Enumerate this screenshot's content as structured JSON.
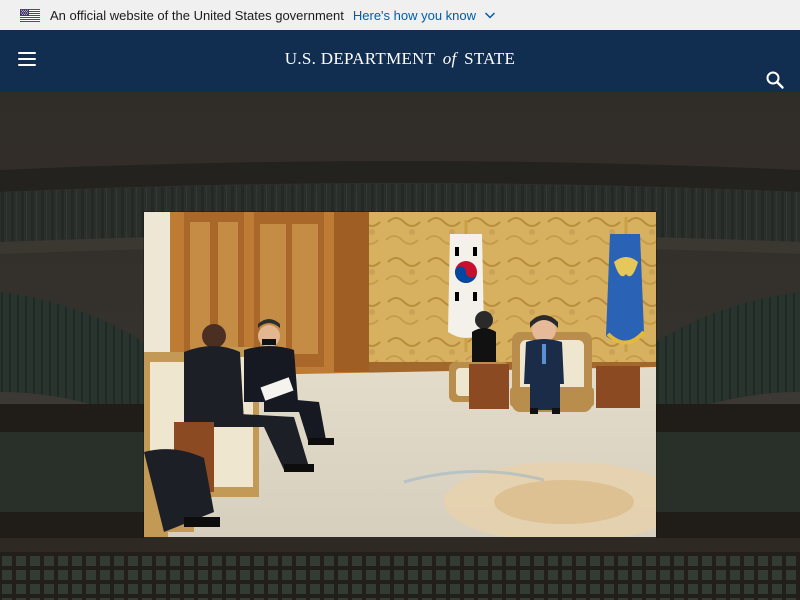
{
  "banner": {
    "flag_icon": "us-flag-icon",
    "official_text": "An official website of the United States government",
    "how_you_know_link": "Here's how you know",
    "chevron_icon": "chevron-down-icon"
  },
  "header": {
    "menu_icon": "hamburger-menu-icon",
    "logo_part1": "U.S. DEPARTMENT",
    "logo_of": "of",
    "logo_part2": "STATE",
    "search_icon": "search-icon",
    "background_color": "#112e51"
  },
  "hero": {
    "background_image": "palace-roof-background",
    "photo": "meeting-photo"
  },
  "colors": {
    "banner_bg": "#f0f0f0",
    "link": "#005ea2",
    "header_bg": "#112e51"
  }
}
